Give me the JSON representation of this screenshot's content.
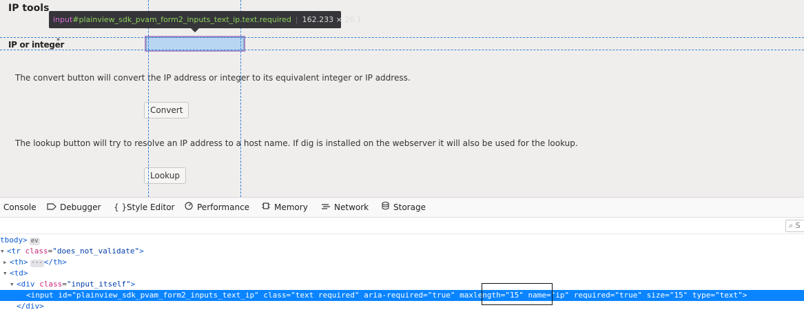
{
  "page": {
    "title": "IP tools",
    "field_label": "IP or integer",
    "required_mark": "*",
    "convert_text": "The convert button will convert the IP address or integer to its equivalent integer or IP address.",
    "convert_button": "Convert",
    "lookup_text": "The lookup button will try to resolve an IP address to a host name. If dig is installed on the webserver it will also be used for the lookup.",
    "lookup_button": "Lookup"
  },
  "inspector_tooltip": {
    "tag": "input",
    "id": "#plainview_sdk_pvam_form2_inputs_text_ip",
    "classes": ".text.required",
    "dimensions": "162.233 × 26.1"
  },
  "devtools": {
    "tabs": [
      {
        "label": "Console",
        "icon": "console-icon"
      },
      {
        "label": "Debugger",
        "icon": "debugger-icon"
      },
      {
        "label": "Style Editor",
        "icon": "style-editor-icon"
      },
      {
        "label": "Performance",
        "icon": "performance-icon"
      },
      {
        "label": "Memory",
        "icon": "memory-icon"
      },
      {
        "label": "Network",
        "icon": "network-icon"
      },
      {
        "label": "Storage",
        "icon": "storage-icon"
      }
    ],
    "search_placeholder": "S",
    "tree": {
      "l1_tag": "tbody>",
      "l1_badge": "ev",
      "l2_open": "<tr",
      "l2_attr": "class",
      "l2_val": "\"does_not_validate\"",
      "l2_close": ">",
      "l3_open": "<th>",
      "l3_badge": "···",
      "l3_close": "</th>",
      "l4_tag": "<td>",
      "l5_open": "<div",
      "l5_attr": "class",
      "l5_val": "\"input_itself\"",
      "l5_close": ">",
      "l6": "<input id=\"plainview_sdk_pvam_form2_inputs_text_ip\" class=\"text required\" aria-required=\"true\" maxlength=\"15\" name=\"ip\" required=\"true\" size=\"15\" type=\"text\">",
      "l7_tag": "</div>"
    }
  },
  "colors": {
    "selection": "#0a84ff",
    "guide": "#2f7fd8",
    "highlight": "#7db4e6"
  }
}
